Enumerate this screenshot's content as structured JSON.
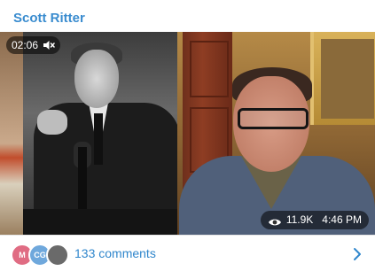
{
  "post": {
    "channel_name": "Scott Ritter"
  },
  "video": {
    "duration": "02:06",
    "mute_icon": "muted-speaker-icon",
    "views_icon": "eye-icon",
    "views": "11.9K",
    "time": "4:46 PM"
  },
  "comments": {
    "avatars": [
      {
        "initial": "M",
        "color": "#e06c83"
      },
      {
        "initial": "CG",
        "color": "#6fa8dc"
      },
      {
        "initial": "",
        "color": "#6a6a6a"
      }
    ],
    "label": "133 comments",
    "chevron_icon": "chevron-right-icon"
  },
  "colors": {
    "accent": "#3a8ccf"
  }
}
